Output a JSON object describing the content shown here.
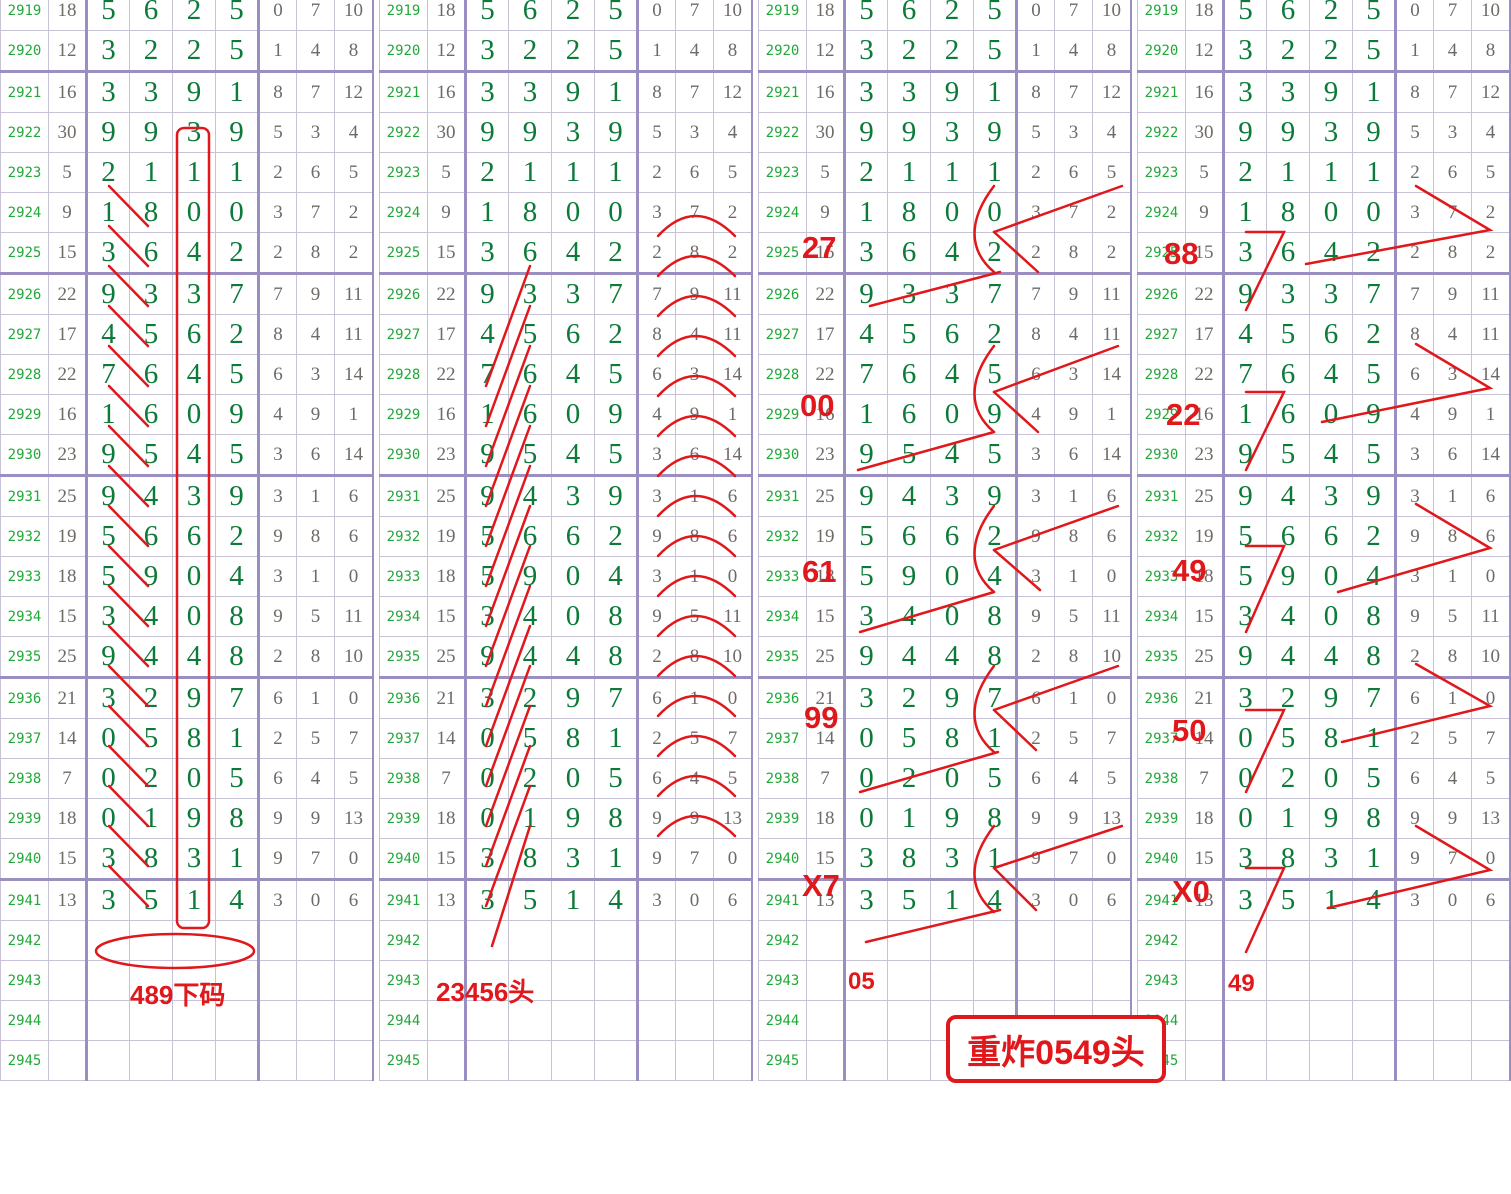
{
  "accent_color": "#e0171b",
  "digit_color": "#0d7a3a",
  "period_color": "#22a83a",
  "rows": [
    {
      "period": "2919",
      "sum": "18",
      "d": [
        "5",
        "6",
        "2",
        "5"
      ],
      "s": [
        "0",
        "7",
        "10"
      ]
    },
    {
      "period": "2920",
      "sum": "12",
      "d": [
        "3",
        "2",
        "2",
        "5"
      ],
      "s": [
        "1",
        "4",
        "8"
      ]
    },
    {
      "period": "2921",
      "sum": "16",
      "d": [
        "3",
        "3",
        "9",
        "1"
      ],
      "s": [
        "8",
        "7",
        "12"
      ]
    },
    {
      "period": "2922",
      "sum": "30",
      "d": [
        "9",
        "9",
        "3",
        "9"
      ],
      "s": [
        "5",
        "3",
        "4"
      ]
    },
    {
      "period": "2923",
      "sum": "5",
      "d": [
        "2",
        "1",
        "1",
        "1"
      ],
      "s": [
        "2",
        "6",
        "5"
      ]
    },
    {
      "period": "2924",
      "sum": "9",
      "d": [
        "1",
        "8",
        "0",
        "0"
      ],
      "s": [
        "3",
        "7",
        "2"
      ]
    },
    {
      "period": "2925",
      "sum": "15",
      "d": [
        "3",
        "6",
        "4",
        "2"
      ],
      "s": [
        "2",
        "8",
        "2"
      ]
    },
    {
      "period": "2926",
      "sum": "22",
      "d": [
        "9",
        "3",
        "3",
        "7"
      ],
      "s": [
        "7",
        "9",
        "11"
      ]
    },
    {
      "period": "2927",
      "sum": "17",
      "d": [
        "4",
        "5",
        "6",
        "2"
      ],
      "s": [
        "8",
        "4",
        "11"
      ]
    },
    {
      "period": "2928",
      "sum": "22",
      "d": [
        "7",
        "6",
        "4",
        "5"
      ],
      "s": [
        "6",
        "3",
        "14"
      ]
    },
    {
      "period": "2929",
      "sum": "16",
      "d": [
        "1",
        "6",
        "0",
        "9"
      ],
      "s": [
        "4",
        "9",
        "1"
      ]
    },
    {
      "period": "2930",
      "sum": "23",
      "d": [
        "9",
        "5",
        "4",
        "5"
      ],
      "s": [
        "3",
        "6",
        "14"
      ]
    },
    {
      "period": "2931",
      "sum": "25",
      "d": [
        "9",
        "4",
        "3",
        "9"
      ],
      "s": [
        "3",
        "1",
        "6"
      ]
    },
    {
      "period": "2932",
      "sum": "19",
      "d": [
        "5",
        "6",
        "6",
        "2"
      ],
      "s": [
        "9",
        "8",
        "6"
      ]
    },
    {
      "period": "2933",
      "sum": "18",
      "d": [
        "5",
        "9",
        "0",
        "4"
      ],
      "s": [
        "3",
        "1",
        "0"
      ]
    },
    {
      "period": "2934",
      "sum": "15",
      "d": [
        "3",
        "4",
        "0",
        "8"
      ],
      "s": [
        "9",
        "5",
        "11"
      ]
    },
    {
      "period": "2935",
      "sum": "25",
      "d": [
        "9",
        "4",
        "4",
        "8"
      ],
      "s": [
        "2",
        "8",
        "10"
      ]
    },
    {
      "period": "2936",
      "sum": "21",
      "d": [
        "3",
        "2",
        "9",
        "7"
      ],
      "s": [
        "6",
        "1",
        "0"
      ]
    },
    {
      "period": "2937",
      "sum": "14",
      "d": [
        "0",
        "5",
        "8",
        "1"
      ],
      "s": [
        "2",
        "5",
        "7"
      ]
    },
    {
      "period": "2938",
      "sum": "7",
      "d": [
        "0",
        "2",
        "0",
        "5"
      ],
      "s": [
        "6",
        "4",
        "5"
      ]
    },
    {
      "period": "2939",
      "sum": "18",
      "d": [
        "0",
        "1",
        "9",
        "8"
      ],
      "s": [
        "9",
        "9",
        "13"
      ]
    },
    {
      "period": "2940",
      "sum": "15",
      "d": [
        "3",
        "8",
        "3",
        "1"
      ],
      "s": [
        "9",
        "7",
        "0"
      ]
    },
    {
      "period": "2941",
      "sum": "13",
      "d": [
        "3",
        "5",
        "1",
        "4"
      ],
      "s": [
        "3",
        "0",
        "6"
      ]
    },
    {
      "period": "2942",
      "sum": "",
      "d": [
        "",
        "",
        "",
        ""
      ],
      "s": [
        "",
        "",
        ""
      ]
    },
    {
      "period": "2943",
      "sum": "",
      "d": [
        "",
        "",
        "",
        ""
      ],
      "s": [
        "",
        "",
        ""
      ]
    },
    {
      "period": "2944",
      "sum": "",
      "d": [
        "",
        "",
        "",
        ""
      ],
      "s": [
        "",
        "",
        ""
      ]
    },
    {
      "period": "2945",
      "sum": "",
      "d": [
        "",
        "",
        "",
        ""
      ],
      "s": [
        "",
        "",
        ""
      ]
    }
  ],
  "annotations": {
    "panel1_label": "489下码",
    "panel2_label": "23456头",
    "panel3_pairs": [
      "27",
      "00",
      "61",
      "99",
      "X7"
    ],
    "panel3_bottom": "05",
    "panel3_box": "重炸0549头",
    "panel4_pairs": [
      "88",
      "22",
      "49",
      "50",
      "X0"
    ],
    "panel4_bottom": "49"
  }
}
